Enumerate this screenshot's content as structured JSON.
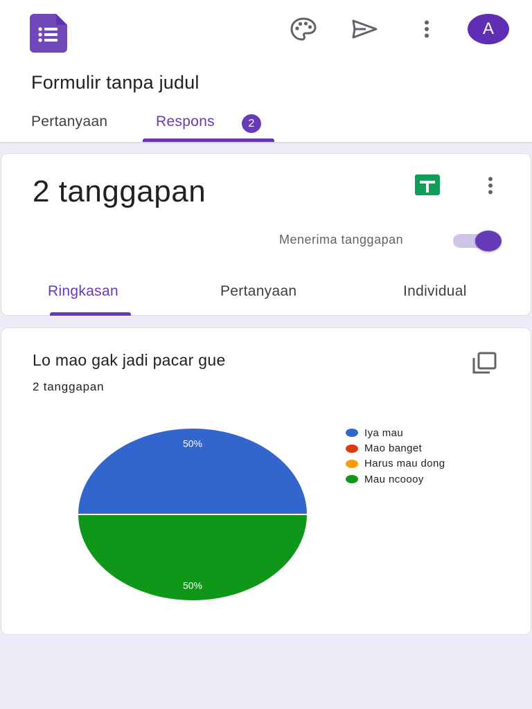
{
  "header": {
    "form_title": "Formulir tanpa judul",
    "avatar_letter": "A",
    "icons": [
      "forms-logo-icon",
      "palette-icon",
      "send-icon",
      "more-vert-icon"
    ],
    "tabs": [
      {
        "label": "Pertanyaan",
        "active": false
      },
      {
        "label": "Respons",
        "active": true,
        "badge": "2"
      }
    ]
  },
  "summary": {
    "count_text": "2 tanggapan",
    "accepting_label": "Menerima tanggapan",
    "accepting": true,
    "icons": [
      "sheets-icon",
      "more-vert-icon"
    ],
    "tabs": [
      {
        "label": "Ringkasan",
        "active": true
      },
      {
        "label": "Pertanyaan",
        "active": false
      },
      {
        "label": "Individual",
        "active": false
      }
    ]
  },
  "question": {
    "title": "Lo mao gak jadi pacar gue",
    "response_count": "2 tanggapan",
    "icon": "copy-icon"
  },
  "chart_data": {
    "type": "pie",
    "categories": [
      "Iya mau",
      "Mao banget",
      "Harus mau dong",
      "Mau ncoooy"
    ],
    "values": [
      50,
      0,
      0,
      50
    ],
    "unit": "%",
    "colors": [
      "#3366cc",
      "#dc3912",
      "#ff9900",
      "#109618"
    ],
    "slice_labels": [
      "50%",
      "",
      "",
      "50%"
    ],
    "legend_position": "right"
  },
  "colors": {
    "accent": "#673ab7",
    "background": "#f0ebf8",
    "avatar": "#5f2eb5",
    "sheets_green": "#0f9d58"
  }
}
